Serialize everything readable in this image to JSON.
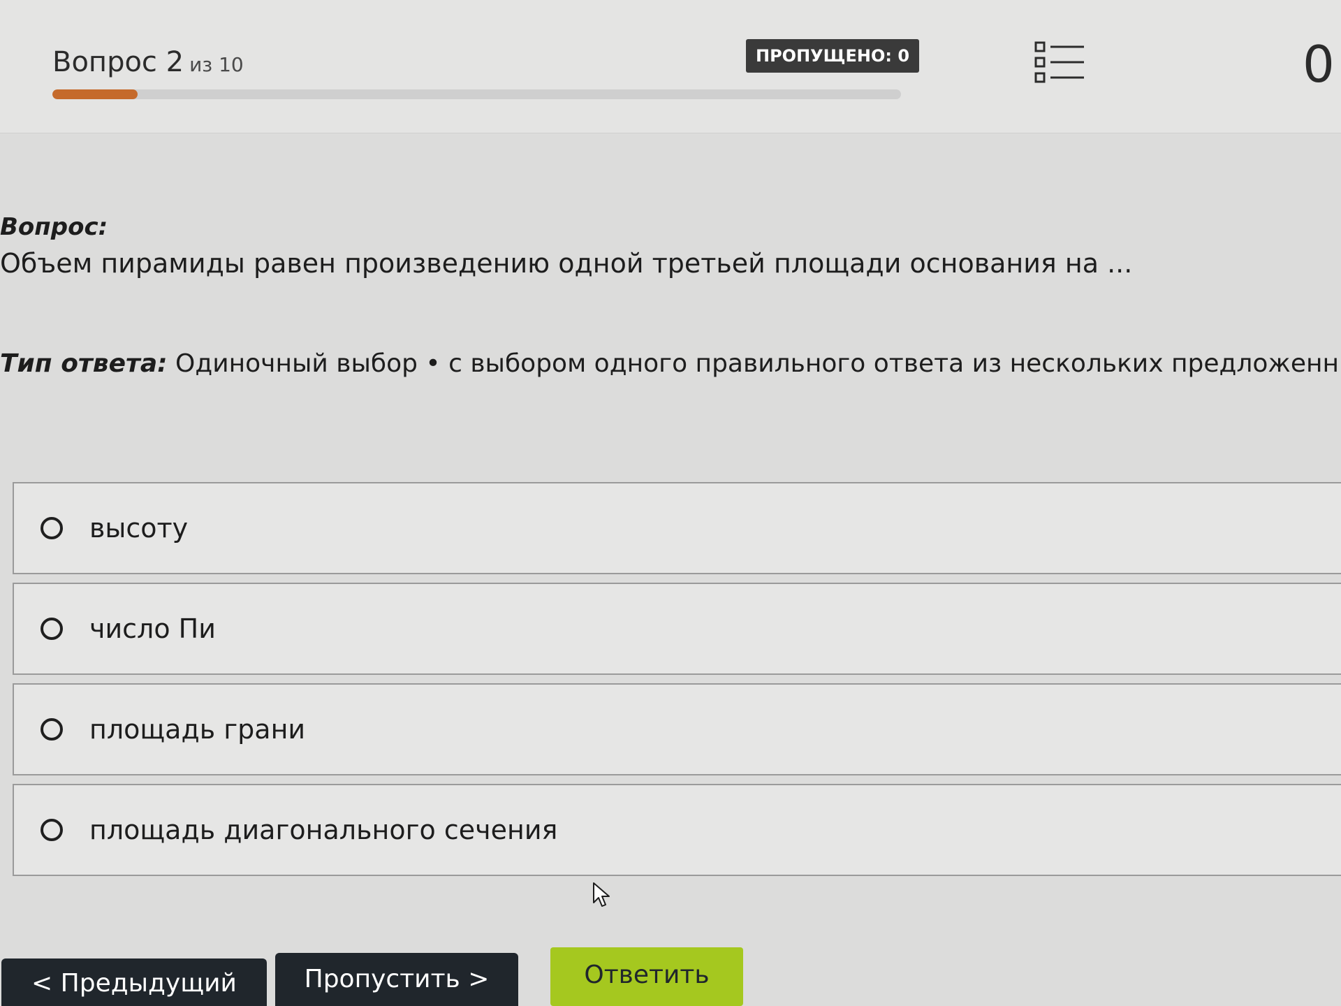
{
  "header": {
    "question_word": "Вопрос 2",
    "question_of": "из 10",
    "progress_fraction": 0.1,
    "skipped_badge": "ПРОПУЩЕНО: 0",
    "questions_list_icon": "list-icon",
    "timer_partial": "0"
  },
  "question": {
    "label": "Вопрос:",
    "text": "Объем пирамиды равен произведению одной третьей площади основания на ..."
  },
  "answer_type": {
    "label": "Тип ответа:",
    "value": "Одиночный выбор • с выбором одного правильного ответа из нескольких предложенных вариант"
  },
  "options": [
    {
      "label": "высоту"
    },
    {
      "label": "число Пи"
    },
    {
      "label": "площадь грани"
    },
    {
      "label": "площадь диагонального сечения"
    }
  ],
  "buttons": {
    "prev": "< Предыдущий",
    "skip": "Пропустить >",
    "answer": "Ответить"
  },
  "colors": {
    "progress": "#c56a2b",
    "answer_button": "#a5c81f",
    "dark_button": "#20262c"
  }
}
